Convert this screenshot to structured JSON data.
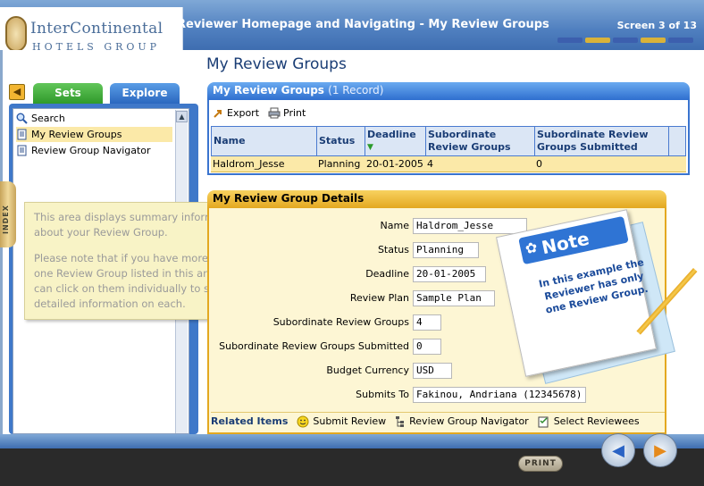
{
  "header": {
    "logo_line1": "InterContinental",
    "logo_line2": "HOTELS GROUP",
    "title": "Reviewer Homepage and Navigating - My Review Groups",
    "screen_count": "Screen 3 of 13"
  },
  "page_title": "My Review Groups",
  "left_panel": {
    "tabs": [
      {
        "label": "Sets"
      },
      {
        "label": "Explore"
      }
    ],
    "items": [
      {
        "label": "Search",
        "icon": "search-icon"
      },
      {
        "label": "My Review Groups",
        "icon": "document-icon"
      },
      {
        "label": "Review Group Navigator",
        "icon": "document-icon"
      }
    ],
    "index_label": "INDEX"
  },
  "tooltip": {
    "p1": "This area displays summary information about your Review Group.",
    "p2": "Please note that if you have more than one Review Group listed in this area you can click on them individually to show detailed information on each."
  },
  "review_groups": {
    "title": "My Review Groups",
    "count": "(1 Record)",
    "toolbar": {
      "export": "Export",
      "print": "Print"
    },
    "columns": [
      "Name",
      "Status",
      "Deadline",
      "Subordinate Review Groups",
      "Subordinate Review Groups Submitted"
    ],
    "rows": [
      {
        "name": "Haldrom_Jesse",
        "status": "Planning",
        "deadline": "20-01-2005",
        "sub_groups": "4",
        "sub_submitted": "0"
      }
    ]
  },
  "details": {
    "title": "My Review Group Details",
    "fields": [
      {
        "label": "Name",
        "value": "Haldrom_Jesse"
      },
      {
        "label": "Status",
        "value": "Planning"
      },
      {
        "label": "Deadline",
        "value": "20-01-2005"
      },
      {
        "label": "Review Plan",
        "value": "Sample Plan"
      },
      {
        "label": "Subordinate Review Groups",
        "value": "4"
      },
      {
        "label": "Subordinate Review Groups Submitted",
        "value": "0"
      },
      {
        "label": "Budget Currency",
        "value": "USD"
      },
      {
        "label": "Submits To",
        "value": "Fakinou, Andriana (12345678)"
      }
    ],
    "related": {
      "title": "Related Items",
      "items": [
        "Submit Review",
        "Review Group Navigator",
        "Select Reviewees"
      ]
    }
  },
  "note": {
    "title": "Note",
    "text": "In this example the Reviewer has only one Review Group."
  },
  "footer": {
    "print": "PRINT"
  },
  "colors": {
    "header_blue": "#4f7fbf",
    "panel_blue": "#2f6fcf",
    "details_gold": "#e3a820",
    "selection_yellow": "#fbe9a8"
  }
}
